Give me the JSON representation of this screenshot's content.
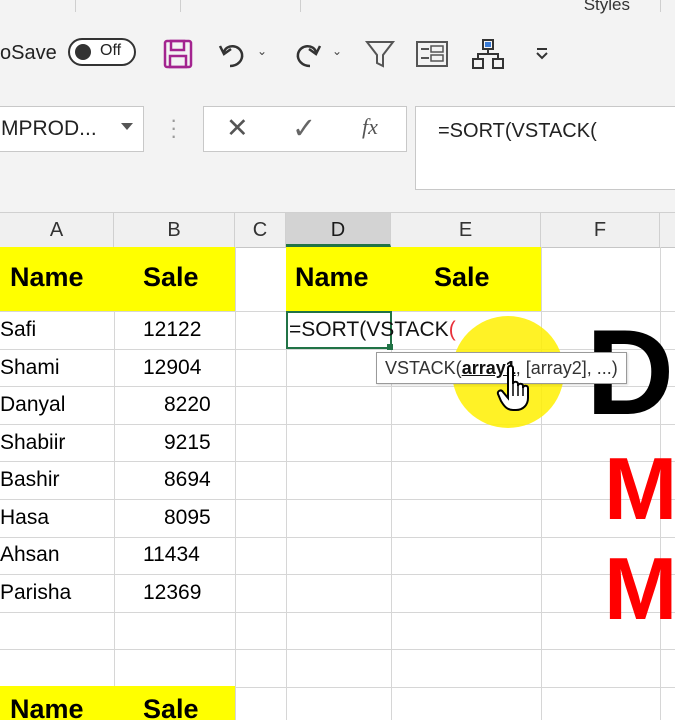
{
  "ribbon": {
    "group_label": "Styles"
  },
  "qat": {
    "autosave_label": "oSave",
    "autosave_state": "Off",
    "icons": [
      "save-icon",
      "undo-icon",
      "redo-icon",
      "filter-icon",
      "form-icon",
      "hierarchy-icon",
      "customize-qat-icon"
    ]
  },
  "name_box": {
    "value": "MPROD..."
  },
  "formula_bar": {
    "cancel_glyph": "✕",
    "enter_glyph": "✓",
    "fx_glyph": "fx",
    "formula": "=SORT(VSTACK("
  },
  "columns": [
    "A",
    "B",
    "C",
    "D",
    "E",
    "F"
  ],
  "table1": {
    "headers": [
      "Name",
      "Sale"
    ],
    "rows": [
      {
        "name": "Safi",
        "sale": "12122"
      },
      {
        "name": "Shami",
        "sale": "12904"
      },
      {
        "name": "Danyal",
        "sale": "8220"
      },
      {
        "name": "Shabiir",
        "sale": "9215"
      },
      {
        "name": "Bashir",
        "sale": "8694"
      },
      {
        "name": "Hasa",
        "sale": "8095"
      },
      {
        "name": "Ahsan",
        "sale": "11434"
      },
      {
        "name": "Parisha",
        "sale": "12369"
      }
    ]
  },
  "table2": {
    "headers": [
      "Name",
      "Sale"
    ]
  },
  "output_table": {
    "headers": [
      "Name",
      "Sale"
    ]
  },
  "active_cell": {
    "text_main": "=SORT(VSTACK",
    "text_paren": "("
  },
  "tooltip": {
    "func": "VSTACK(",
    "current_arg": "array1",
    "rest": ", [array2], ...)"
  },
  "overlay": {
    "letter1": "D",
    "letter2": "M",
    "letter3": "M"
  },
  "colors": {
    "highlight_yellow": "#ffff00",
    "excel_green": "#217346",
    "overlay_red": "#ff0000",
    "paren_red": "#e8303a"
  }
}
